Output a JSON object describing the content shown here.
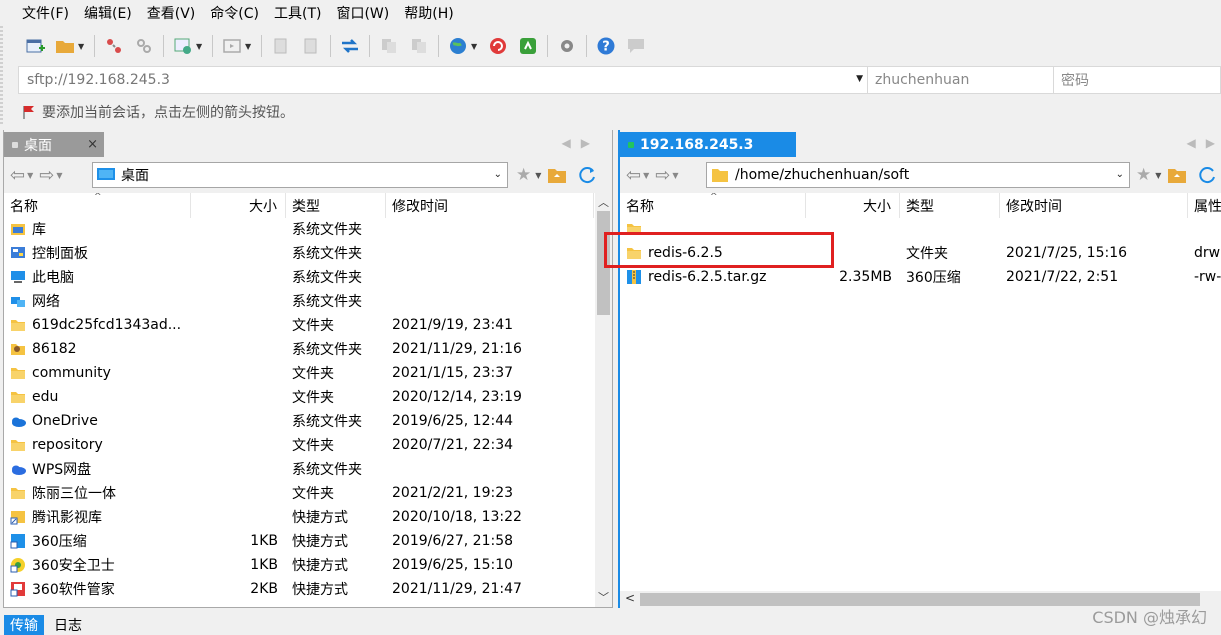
{
  "menu": [
    "文件(F)",
    "编辑(E)",
    "查看(V)",
    "命令(C)",
    "工具(T)",
    "窗口(W)",
    "帮助(H)"
  ],
  "address": {
    "host": "sftp://192.168.245.3",
    "user": "zhuchenhuan",
    "password_placeholder": "密码"
  },
  "hint": "要添加当前会话，点击左侧的箭头按钮。",
  "left_pane": {
    "tab_label": "桌面",
    "path": "桌面",
    "columns": [
      "名称",
      "大小",
      "类型",
      "修改时间"
    ],
    "rows": [
      {
        "icon": "library-icon",
        "name": "库",
        "size": "",
        "type": "系统文件夹",
        "modified": ""
      },
      {
        "icon": "control-panel-icon",
        "name": "控制面板",
        "size": "",
        "type": "系统文件夹",
        "modified": ""
      },
      {
        "icon": "computer-icon",
        "name": "此电脑",
        "size": "",
        "type": "系统文件夹",
        "modified": ""
      },
      {
        "icon": "network-icon",
        "name": "网络",
        "size": "",
        "type": "系统文件夹",
        "modified": ""
      },
      {
        "icon": "folder-icon",
        "name": "619dc25fcd1343ad...",
        "size": "",
        "type": "文件夹",
        "modified": "2021/9/19, 23:41"
      },
      {
        "icon": "user-folder-icon",
        "name": "86182",
        "size": "",
        "type": "系统文件夹",
        "modified": "2021/11/29, 21:16"
      },
      {
        "icon": "folder-icon",
        "name": "community",
        "size": "",
        "type": "文件夹",
        "modified": "2021/1/15, 23:37"
      },
      {
        "icon": "folder-icon",
        "name": "edu",
        "size": "",
        "type": "文件夹",
        "modified": "2020/12/14, 23:19"
      },
      {
        "icon": "onedrive-icon",
        "name": "OneDrive",
        "size": "",
        "type": "系统文件夹",
        "modified": "2019/6/25, 12:44"
      },
      {
        "icon": "folder-icon",
        "name": "repository",
        "size": "",
        "type": "文件夹",
        "modified": "2020/7/21, 22:34"
      },
      {
        "icon": "wps-cloud-icon",
        "name": "WPS网盘",
        "size": "",
        "type": "系统文件夹",
        "modified": ""
      },
      {
        "icon": "folder-icon",
        "name": "陈丽三位一体",
        "size": "",
        "type": "文件夹",
        "modified": "2021/2/21, 19:23"
      },
      {
        "icon": "shortcut-icon",
        "name": "腾讯影视库",
        "size": "",
        "type": "快捷方式",
        "modified": "2020/10/18, 13:22"
      },
      {
        "icon": "zip-shortcut-icon",
        "name": "360压缩",
        "size": "1KB",
        "type": "快捷方式",
        "modified": "2019/6/27, 21:58"
      },
      {
        "icon": "security-shortcut-icon",
        "name": "360安全卫士",
        "size": "1KB",
        "type": "快捷方式",
        "modified": "2019/6/25, 15:10"
      },
      {
        "icon": "software-shortcut-icon",
        "name": "360软件管家",
        "size": "2KB",
        "type": "快捷方式",
        "modified": "2021/11/29, 21:47"
      }
    ]
  },
  "right_pane": {
    "tab_label": "192.168.245.3",
    "path": "/home/zhuchenhuan/soft",
    "columns": [
      "名称",
      "大小",
      "类型",
      "修改时间",
      "属性"
    ],
    "rows": [
      {
        "icon": "folder-icon",
        "name": "",
        "size": "",
        "type": "",
        "modified": "",
        "attr": ""
      },
      {
        "icon": "folder-icon",
        "name": "redis-6.2.5",
        "size": "",
        "type": "文件夹",
        "modified": "2021/7/25, 15:16",
        "attr": "drw"
      },
      {
        "icon": "archive-icon",
        "name": "redis-6.2.5.tar.gz",
        "size": "2.35MB",
        "type": "360压缩",
        "modified": "2021/7/22, 2:51",
        "attr": "-rw-"
      }
    ]
  },
  "bottom_tabs": [
    "传输",
    "日志"
  ],
  "watermark": "CSDN @烛承幻",
  "colors": {
    "accent": "#1a8be6",
    "highlight": "#e02020",
    "folder": "#f5c342"
  }
}
